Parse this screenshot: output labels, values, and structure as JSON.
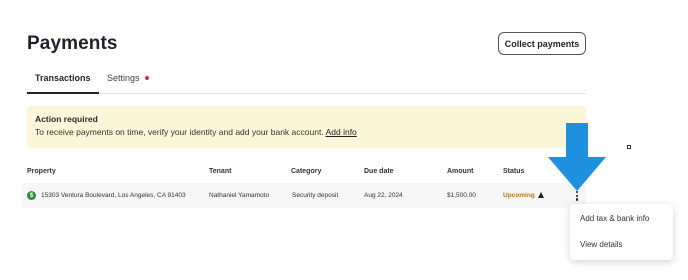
{
  "header": {
    "title": "Payments",
    "collect_button": "Collect payments"
  },
  "tabs": [
    {
      "label": "Transactions",
      "active": true
    },
    {
      "label": "Settings",
      "has_alert_dot": true
    }
  ],
  "alert": {
    "title": "Action required",
    "body": "To receive payments on time, verify your identity and add your bank account.",
    "link": "Add info",
    "color": "#fbf6d8"
  },
  "table": {
    "columns": [
      "Property",
      "Tenant",
      "Category",
      "Due date",
      "Amount",
      "Status"
    ],
    "rows": [
      {
        "icon": "dollar-icon",
        "property": "15303 Ventura Boulevard, Los Angeles, CA 91403",
        "tenant": "Nathaniel Yamamoto",
        "category": "Security deposit",
        "due_date": "Aug 22, 2024",
        "amount": "$1,500.00",
        "status": "Upcoming",
        "status_icon": "warning-icon"
      }
    ]
  },
  "row_menu": {
    "items": [
      "Add tax & bank info",
      "View details"
    ]
  },
  "colors": {
    "status_upcoming": "#b07a12",
    "arrow": "#1e90e0",
    "dot": "#d7263d"
  }
}
